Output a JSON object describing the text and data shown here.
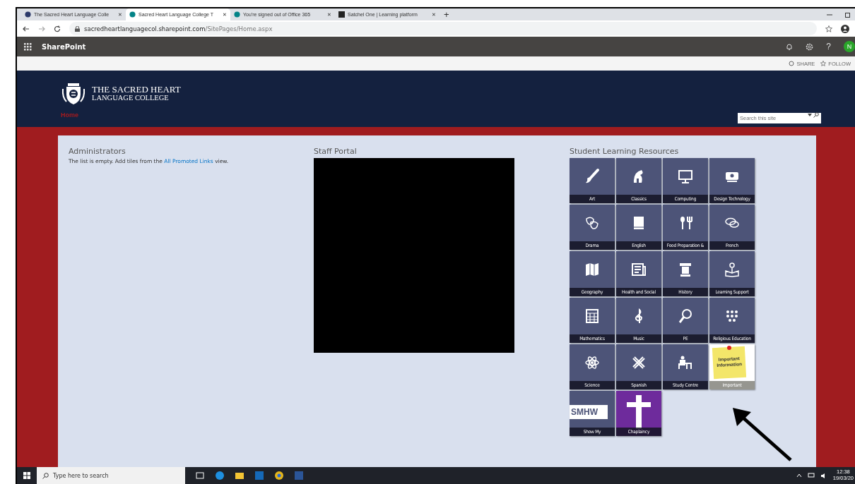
{
  "browser": {
    "tabs": [
      {
        "title": "The Sacred Heart Language Colle",
        "close": "✕",
        "selected": false
      },
      {
        "title": "Sacred Heart Language College T",
        "close": "✕",
        "selected": true
      },
      {
        "title": "You're signed out of Office 365",
        "close": "✕",
        "selected": false
      },
      {
        "title": "Satchel One | Learning platform",
        "close": "✕",
        "selected": false
      }
    ],
    "new_tab": "+",
    "url_host": "sacredheartlanguagecol.sharepoint.com",
    "url_path": "/SitePages/Home.aspx"
  },
  "suite_bar": {
    "title": "SharePoint",
    "help": "?",
    "avatar": "N"
  },
  "actions": [
    {
      "label": "SHARE"
    },
    {
      "label": "FOLLOW"
    }
  ],
  "site": {
    "name_line1": "THE SACRED HEART",
    "name_line2": "LANGUAGE COLLEGE",
    "nav": [
      {
        "label": "Home",
        "selected": true
      }
    ],
    "search_placeholder": "Search this site"
  },
  "administrators": {
    "title": "Administrators",
    "text_before": "The list is empty. Add tiles from the ",
    "link": "All Promoted Links",
    "text_after": " view."
  },
  "staff_portal": {
    "title": "Staff Portal"
  },
  "resources": {
    "title": "Student Learning Resources",
    "tiles": [
      {
        "label": "Art",
        "kind": "icon"
      },
      {
        "label": "Classics",
        "kind": "icon"
      },
      {
        "label": "Computing",
        "kind": "icon"
      },
      {
        "label": "Design Technology",
        "kind": "icon"
      },
      {
        "label": "Drama",
        "kind": "icon"
      },
      {
        "label": "English",
        "kind": "icon"
      },
      {
        "label": "Food Preparation &",
        "kind": "icon"
      },
      {
        "label": "French",
        "kind": "icon"
      },
      {
        "label": "Geography",
        "kind": "icon"
      },
      {
        "label": "Health and Social",
        "kind": "icon"
      },
      {
        "label": "History",
        "kind": "icon"
      },
      {
        "label": "Learning Support",
        "kind": "icon"
      },
      {
        "label": "Mathematics",
        "kind": "icon"
      },
      {
        "label": "Music",
        "kind": "icon"
      },
      {
        "label": "PE",
        "kind": "icon"
      },
      {
        "label": "Religious Education",
        "kind": "icon"
      },
      {
        "label": "Science",
        "kind": "icon"
      },
      {
        "label": "Spanish",
        "kind": "icon"
      },
      {
        "label": "Study Centre",
        "kind": "icon"
      },
      {
        "label": "Important",
        "kind": "note",
        "note_text": "Important Information"
      },
      {
        "label": "Show My",
        "kind": "banner",
        "banner_text": "SMHW"
      },
      {
        "label": "Chaplaincy",
        "kind": "cross"
      }
    ]
  },
  "taskbar": {
    "search_placeholder": "Type here to search",
    "time": "12:38",
    "date": "19/03/20"
  }
}
